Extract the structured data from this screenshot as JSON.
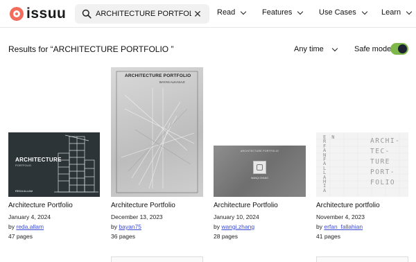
{
  "header": {
    "logo_text": "issuu",
    "search": {
      "value": "ARCHITECTURE PORTFOLIO",
      "placeholder": ""
    },
    "nav": [
      {
        "label": "Read"
      },
      {
        "label": "Features"
      },
      {
        "label": "Use Cases"
      },
      {
        "label": "Learn"
      }
    ]
  },
  "results": {
    "label": "Results for “ARCHITECTURE PORTFOLIO ”",
    "time_filter": "Any time",
    "safe_mode_label": "Safe mode",
    "safe_mode_on": true
  },
  "colors": {
    "brand": "#f36d5d",
    "toggle_track": "#7fb84a",
    "toggle_knob": "#1c2434",
    "link": "#3b4bd3"
  },
  "cards": [
    {
      "title": "Architecture Portfolio",
      "date": "January 4, 2024",
      "by_prefix": "by",
      "author": "reda.allam",
      "pages": "47 pages",
      "cover": {
        "title": "ARCHITECTURE",
        "subtitle": "PORTFOLIO",
        "name": "REDA ALLAM"
      }
    },
    {
      "title": "Architecture Portfolio",
      "date": "December 13, 2023",
      "by_prefix": "by",
      "author": "bayan75",
      "pages": "36 pages",
      "cover": {
        "title": "ARCHITECTURE PORTFOLIO",
        "name": "BAYAN ALKASAJI"
      }
    },
    {
      "title": "Architecture Portfolio",
      "date": "January 10, 2024",
      "by_prefix": "by",
      "author": "wangi.zhang",
      "pages": "28 pages",
      "cover": {
        "title": "ARCHITECTURE PORTFOLIO",
        "name": "WANQI ZHANG"
      }
    },
    {
      "title": "Architecture portfolio",
      "date": "November 4, 2023",
      "by_prefix": "by",
      "author": "erfan_fallahian",
      "pages": "41 pages",
      "cover": {
        "left": [
          "E",
          "R",
          "F",
          "A",
          "N",
          "F",
          "A",
          "L",
          "L",
          "A",
          "H",
          "I",
          "A",
          "N"
        ],
        "right": [
          "ARCHI-",
          "TEC-",
          "TURE",
          "PORT-",
          "FOLIO"
        ]
      }
    }
  ]
}
